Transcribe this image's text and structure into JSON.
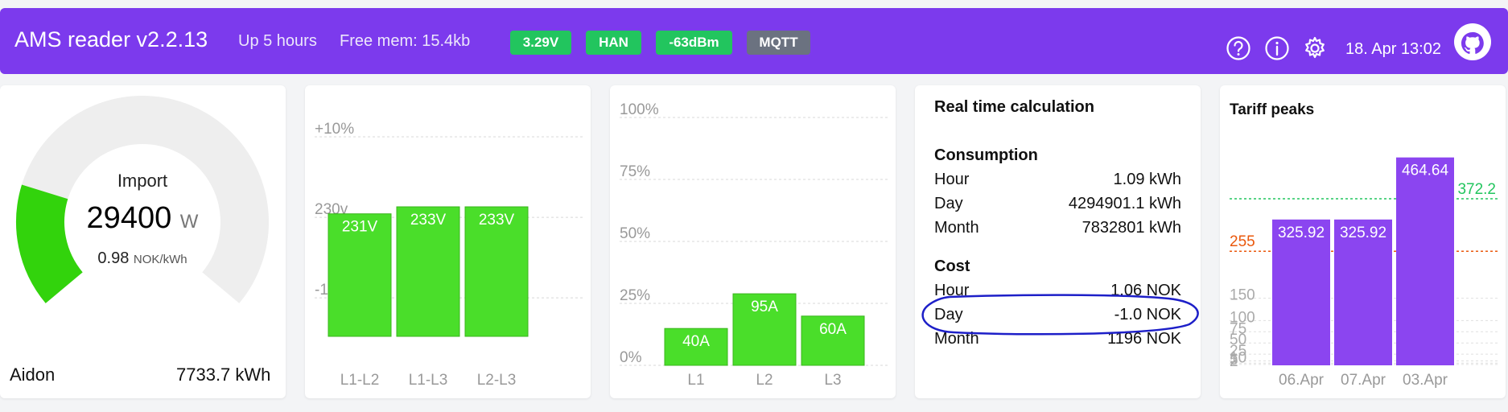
{
  "header": {
    "title": "AMS reader v2.2.13",
    "uptime": "Up 5 hours",
    "free_mem": "Free mem: 15.4kb",
    "badges": [
      {
        "label": "3.29V",
        "color": "#22c55e"
      },
      {
        "label": "HAN",
        "color": "#22c55e"
      },
      {
        "label": "-63dBm",
        "color": "#22c55e"
      },
      {
        "label": "MQTT",
        "color": "#6b7280"
      }
    ],
    "icons": [
      "help-icon",
      "info-icon",
      "gear-icon",
      "github-icon"
    ],
    "datetime": "18. Apr 13:02",
    "accent": "#7c3aed"
  },
  "gauge": {
    "title": "Import",
    "value": "29400",
    "unit": "W",
    "price": "0.98",
    "price_unit": "NOK/kWh",
    "meter_model": "Aidon",
    "meter_total": "7733.7 kWh",
    "fill_fraction": 0.22,
    "fill_color": "#32d30c",
    "track_color": "#eeeeee"
  },
  "voltage_chart": {
    "y_ticks": [
      "+10%",
      "230v",
      "-10%"
    ],
    "ylim": [
      207,
      253
    ],
    "tick_values": [
      253,
      230,
      207
    ],
    "categories": [
      "L1-L2",
      "L1-L3",
      "L2-L3"
    ],
    "values": [
      231,
      233,
      233
    ],
    "value_labels": [
      "231V",
      "233V",
      "233V"
    ],
    "bar_color": "#4ade2a"
  },
  "current_chart": {
    "y_ticks": [
      "100%",
      "75%",
      "50%",
      "25%",
      "0%"
    ],
    "tick_values": [
      100,
      75,
      50,
      25,
      0
    ],
    "categories": [
      "L1",
      "L2",
      "L3"
    ],
    "values": [
      10,
      24,
      15
    ],
    "value_labels": [
      "40A",
      "95A",
      "60A"
    ],
    "bar_color": "#4ade2a"
  },
  "realtime": {
    "title": "Real time calculation",
    "consumption_title": "Consumption",
    "consumption": [
      {
        "label": "Hour",
        "value": "1.09 kWh"
      },
      {
        "label": "Day",
        "value": "4294901.1 kWh"
      },
      {
        "label": "Month",
        "value": "7832801 kWh"
      }
    ],
    "cost_title": "Cost",
    "cost": [
      {
        "label": "Hour",
        "value": "1.06 NOK"
      },
      {
        "label": "Day",
        "value": "-1.0 NOK"
      },
      {
        "label": "Month",
        "value": "1196 NOK"
      }
    ],
    "highlight_color": "#1d1fc8"
  },
  "tariff": {
    "title": "Tariff peaks",
    "categories": [
      "06.Apr",
      "07.Apr",
      "03.Apr"
    ],
    "values": [
      325.92,
      325.92,
      464.64
    ],
    "value_labels": [
      "325.92",
      "325.92",
      "464.64"
    ],
    "y_ticks": [
      "150",
      "100",
      "75",
      "50",
      "25",
      "10",
      "5",
      "2"
    ],
    "tick_values": [
      150,
      100,
      75,
      50,
      25,
      10,
      5,
      2
    ],
    "thresholds": [
      {
        "label": "372.2",
        "value": 372.2,
        "color": "#22c55e"
      },
      {
        "label": "255",
        "value": 255,
        "color": "#ea580c"
      }
    ],
    "ylim": [
      0,
      500
    ],
    "bar_color": "#8b45f0"
  }
}
